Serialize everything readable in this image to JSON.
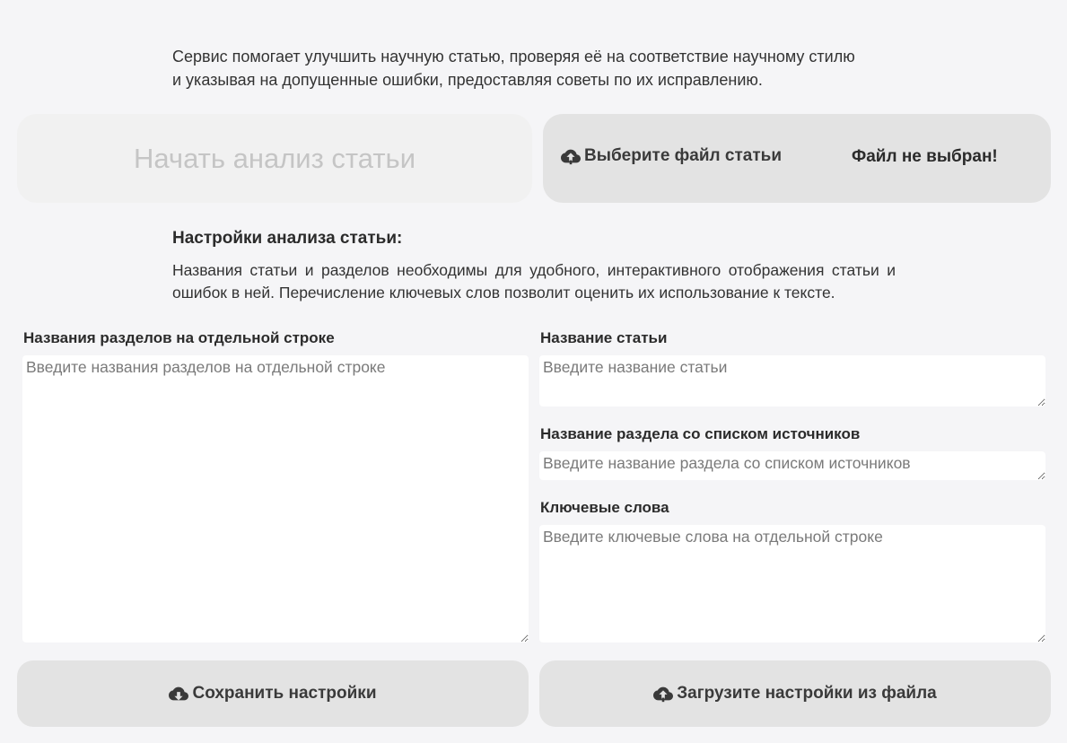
{
  "intro": {
    "line1": "Сервис помогает улучшить научную статью, проверяя её на соответствие научному стилю",
    "line2": "и указывая на допущенные ошибки, предоставляя советы по их исправлению."
  },
  "actions": {
    "start_label": "Начать анализ статьи",
    "choose_file_label": "Выберите файл статьи",
    "file_status": "Файл не выбран!",
    "choose_file_icon": "cloud-upload-icon"
  },
  "settings": {
    "title": "Настройки анализа статьи:",
    "description": "Названия статьи и разделов необходимы для удобного, интерактивного отображения статьи и ошибок в ней. Перечисление ключевых слов позволит оценить их использование к тексте."
  },
  "fields": {
    "sections": {
      "label": "Названия разделов на отдельной строке",
      "placeholder": "Введите названия разделов на отдельной строке",
      "value": ""
    },
    "title": {
      "label": "Название статьи",
      "placeholder": "Введите название статьи",
      "value": ""
    },
    "references": {
      "label": "Название раздела со списком источников",
      "placeholder": "Введите название раздела со списком источников",
      "value": ""
    },
    "keywords": {
      "label": "Ключевые слова",
      "placeholder": "Введите ключевые слова на отдельной строке",
      "value": ""
    }
  },
  "footer": {
    "save_label": "Сохранить настройки",
    "save_icon": "cloud-download-icon",
    "load_label": "Загрузите настройки из файла",
    "load_icon": "cloud-upload-icon"
  },
  "colors": {
    "background": "#f5f5f7",
    "button": "#e3e3e3",
    "button_disabled": "#f1f1f1",
    "disabled_text": "#c5c5c5"
  }
}
